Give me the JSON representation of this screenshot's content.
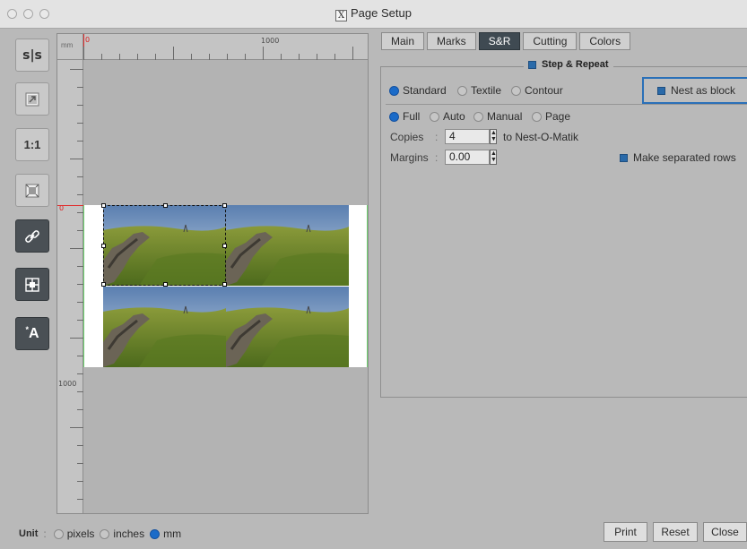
{
  "window": {
    "title": "Page Setup"
  },
  "toolbar": {
    "fit_label": "s|s",
    "actual_size_label": "1:1",
    "text_label": "A"
  },
  "ruler": {
    "unit": "mm",
    "zero": "0",
    "top_mark": "1000",
    "left_mark": "1000",
    "left_zero": "0"
  },
  "tabs": [
    {
      "label": "Main",
      "active": false
    },
    {
      "label": "Marks",
      "active": false
    },
    {
      "label": "S&R",
      "active": true
    },
    {
      "label": "Cutting",
      "active": false
    },
    {
      "label": "Colors",
      "active": false
    }
  ],
  "step_repeat": {
    "group_title": "Step & Repeat",
    "checked": true,
    "modes": [
      {
        "label": "Standard",
        "selected": true
      },
      {
        "label": "Textile",
        "selected": false
      },
      {
        "label": "Contour",
        "selected": false
      }
    ],
    "nest_as_block": {
      "label": "Nest as block",
      "checked": true
    },
    "fill_modes": [
      {
        "label": "Full",
        "selected": true
      },
      {
        "label": "Auto",
        "selected": false
      },
      {
        "label": "Manual",
        "selected": false
      },
      {
        "label": "Page",
        "selected": false
      }
    ],
    "copies": {
      "label": "Copies",
      "value": "4",
      "suffix": "to Nest-O-Matik"
    },
    "margins": {
      "label": "Margins",
      "value": "0.00"
    },
    "make_separated_rows": {
      "label": "Make separated rows",
      "checked": true
    }
  },
  "unit": {
    "label": "Unit",
    "options": [
      {
        "label": "pixels",
        "selected": false
      },
      {
        "label": "inches",
        "selected": false
      },
      {
        "label": "mm",
        "selected": true
      }
    ]
  },
  "buttons": {
    "print": "Print",
    "reset": "Reset",
    "close": "Close"
  },
  "colors": {
    "accent": "#2a6aa9",
    "active_tab": "#3f4a52",
    "tool_dark": "#4a5055"
  }
}
